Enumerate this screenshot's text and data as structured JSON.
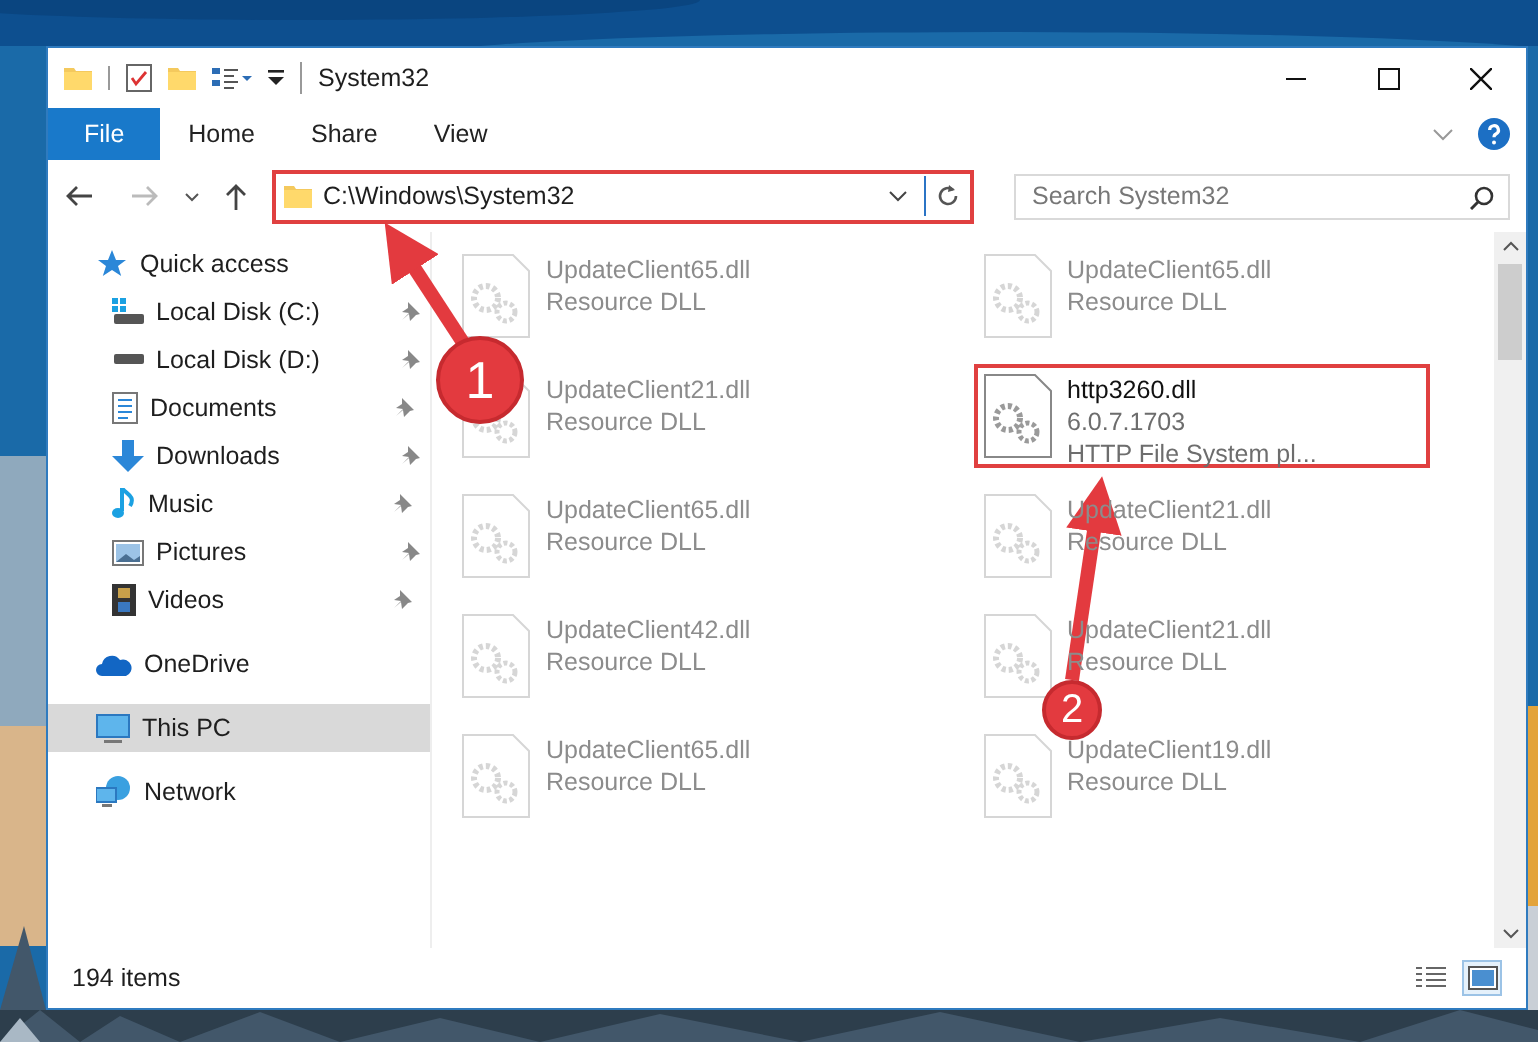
{
  "window": {
    "title": "System32"
  },
  "ribbon_tabs": [
    {
      "label": "File",
      "selected": true
    },
    {
      "label": "Home",
      "selected": false
    },
    {
      "label": "Share",
      "selected": false
    },
    {
      "label": "View",
      "selected": false
    }
  ],
  "address": {
    "path": "C:\\Windows\\System32",
    "highlighted": true
  },
  "search": {
    "placeholder": "Search System32"
  },
  "sidebar": {
    "items": [
      {
        "kind": "star",
        "label": "Quick access",
        "selected": false,
        "pinned": false,
        "children": [
          {
            "kind": "disk-c",
            "label": "Local Disk (C:)",
            "selected": false,
            "pinned": true
          },
          {
            "kind": "disk",
            "label": "Local Disk (D:)",
            "selected": false,
            "pinned": true
          },
          {
            "kind": "documents",
            "label": "Documents",
            "selected": false,
            "pinned": true
          },
          {
            "kind": "downloads",
            "label": "Downloads",
            "selected": false,
            "pinned": true
          },
          {
            "kind": "music",
            "label": "Music",
            "selected": false,
            "pinned": true
          },
          {
            "kind": "pictures",
            "label": "Pictures",
            "selected": false,
            "pinned": true
          },
          {
            "kind": "videos",
            "label": "Videos",
            "selected": false,
            "pinned": true
          }
        ]
      },
      {
        "kind": "cloud",
        "label": "OneDrive",
        "selected": false,
        "pinned": false
      },
      {
        "kind": "pc",
        "label": "This PC",
        "selected": true,
        "pinned": false
      },
      {
        "kind": "network",
        "label": "Network",
        "selected": false,
        "pinned": false
      }
    ]
  },
  "files": [
    {
      "name": "UpdateClient65.dll",
      "line_2": "Resource DLL",
      "dimmed": true,
      "highlighted": false
    },
    {
      "name": "UpdateClient65.dll",
      "line_2": "Resource DLL",
      "dimmed": true,
      "highlighted": false
    },
    {
      "name": "UpdateClient21.dll",
      "line_2": "Resource DLL",
      "dimmed": true,
      "highlighted": false
    },
    {
      "name": "http3260.dll",
      "line_2": "6.0.7.1703",
      "line_3": "HTTP File System pl...",
      "dimmed": false,
      "highlighted": true
    },
    {
      "name": "UpdateClient65.dll",
      "line_2": "Resource DLL",
      "dimmed": true,
      "highlighted": false
    },
    {
      "name": "UpdateClient21.dll",
      "line_2": "Resource DLL",
      "dimmed": true,
      "highlighted": false
    },
    {
      "name": "UpdateClient42.dll",
      "line_2": "Resource DLL",
      "dimmed": true,
      "highlighted": false
    },
    {
      "name": "UpdateClient21.dll",
      "line_2": "Resource DLL",
      "dimmed": true,
      "highlighted": false
    },
    {
      "name": "UpdateClient65.dll",
      "line_2": "Resource DLL",
      "dimmed": true,
      "highlighted": false
    },
    {
      "name": "UpdateClient19.dll",
      "line_2": "Resource DLL",
      "dimmed": true,
      "highlighted": false
    }
  ],
  "status_bar": {
    "text": "194 items",
    "views": [
      {
        "kind": "details",
        "selected": false
      },
      {
        "kind": "large-icons",
        "selected": true
      }
    ]
  },
  "annotations": [
    {
      "label": "1"
    },
    {
      "label": "2"
    }
  ]
}
